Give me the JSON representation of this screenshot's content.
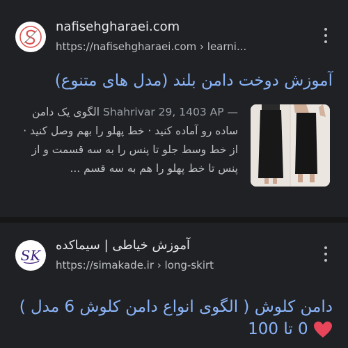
{
  "results": [
    {
      "site_name": "nafisehgharaei.com",
      "url": "https://nafisehgharaei.com › learni...",
      "title": "آموزش دوخت دامن بلند (مدل های متنوع)",
      "date": "Shahrivar 29, 1403 AP —",
      "snippet": "الگوی یک دامن ساده رو آماده کنید · خط پهلو را بهم وصل کنید · از خط وسط جلو تا پنس را به سه قسمت و از پنس تا خط پهلو را هم به سه قسم ..."
    },
    {
      "site_name": "آموزش خیاطی | سیماکده",
      "url": "https://simakade.ir › long-skirt",
      "title_part1": "دامن کلوش ( الگوی انواع دامن کلوش 6 مدل )",
      "title_part2": "0 تا 100"
    }
  ],
  "colors": {
    "background": "#202124",
    "title_link": "#8ab4f8",
    "heart": "#e8455b"
  },
  "icons": {
    "more": "three-dots-vertical",
    "heart": "red-heart-emoji"
  }
}
